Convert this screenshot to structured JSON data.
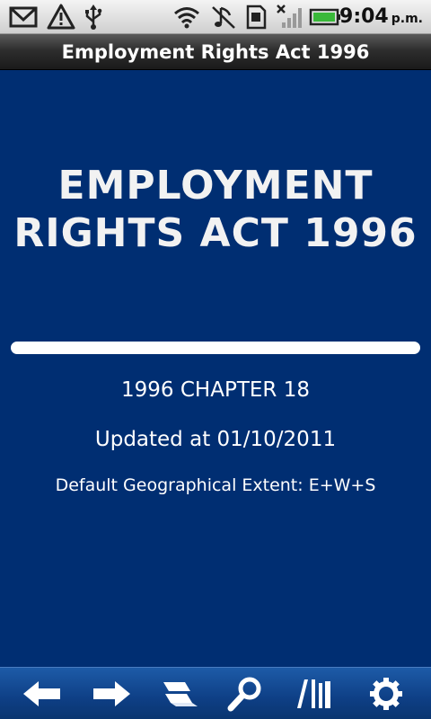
{
  "status_bar": {
    "time": "9:04",
    "ampm": "p.m.",
    "icons": [
      "gmail-icon",
      "warning-icon",
      "usb-icon",
      "wifi-icon",
      "music-off-icon",
      "sim-icon",
      "signal-icon",
      "battery-icon"
    ]
  },
  "title_bar": {
    "title": "Employment Rights Act 1996"
  },
  "main": {
    "heading_line1": "EMPLOYMENT",
    "heading_line2": "RIGHTS ACT 1996",
    "chapter": "1996 CHAPTER 18",
    "updated": "Updated at 01/10/2011",
    "extent": "Default Geographical Extent: E+W+S"
  },
  "toolbar": {
    "buttons": [
      "back-icon",
      "forward-icon",
      "contents-icon",
      "search-icon",
      "library-icon",
      "settings-icon"
    ]
  },
  "colors": {
    "background": "#002e72",
    "toolbar": "#0e3f85",
    "text": "#ffffff"
  }
}
